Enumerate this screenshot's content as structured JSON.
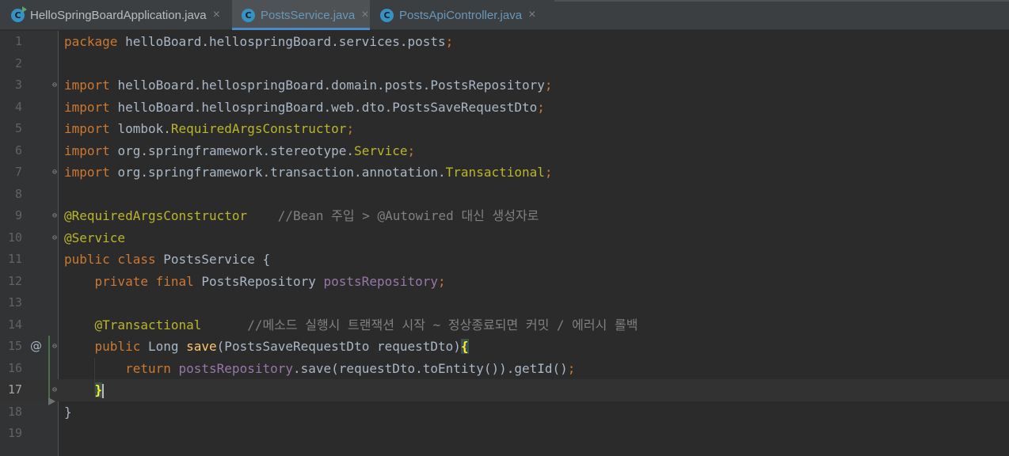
{
  "tabs": [
    {
      "label": "HelloSpringBoardApplication.java",
      "icon": "class-run-icon",
      "active": false
    },
    {
      "label": "PostsService.java",
      "icon": "class-icon",
      "active": true
    },
    {
      "label": "PostsApiController.java",
      "icon": "class-icon",
      "active": false
    }
  ],
  "tab_close_glyph": "×",
  "tab_icon_letter": "C",
  "gutter_marker": "@",
  "current_line": 17,
  "lines": [
    {
      "n": "1",
      "t": [
        [
          "kw",
          "package "
        ],
        [
          "pl",
          "helloBoard.hellospringBoard.services.posts"
        ],
        [
          "kw",
          ";"
        ]
      ]
    },
    {
      "n": "2",
      "t": []
    },
    {
      "n": "3",
      "t": [
        [
          "kw",
          "import "
        ],
        [
          "pl",
          "helloBoard.hellospringBoard.domain.posts.PostsRepository"
        ],
        [
          "kw",
          ";"
        ]
      ]
    },
    {
      "n": "4",
      "t": [
        [
          "kw",
          "import "
        ],
        [
          "pl",
          "helloBoard.hellospringBoard.web.dto.PostsSaveRequestDto"
        ],
        [
          "kw",
          ";"
        ]
      ]
    },
    {
      "n": "5",
      "t": [
        [
          "kw",
          "import "
        ],
        [
          "pl",
          "lombok."
        ],
        [
          "an",
          "RequiredArgsConstructor"
        ],
        [
          "kw",
          ";"
        ]
      ]
    },
    {
      "n": "6",
      "t": [
        [
          "kw",
          "import "
        ],
        [
          "pl",
          "org.springframework.stereotype."
        ],
        [
          "an",
          "Service"
        ],
        [
          "kw",
          ";"
        ]
      ]
    },
    {
      "n": "7",
      "t": [
        [
          "kw",
          "import "
        ],
        [
          "pl",
          "org.springframework.transaction.annotation."
        ],
        [
          "an",
          "Transactional"
        ],
        [
          "kw",
          ";"
        ]
      ]
    },
    {
      "n": "8",
      "t": []
    },
    {
      "n": "9",
      "t": [
        [
          "an",
          "@RequiredArgsConstructor"
        ],
        [
          "cm",
          "    //Bean 주입 > @Autowired 대신 생성자로"
        ]
      ]
    },
    {
      "n": "10",
      "t": [
        [
          "an",
          "@Service"
        ]
      ]
    },
    {
      "n": "11",
      "t": [
        [
          "kw",
          "public class "
        ],
        [
          "pl",
          "PostsService {"
        ]
      ]
    },
    {
      "n": "12",
      "t": [
        [
          "pl",
          "    "
        ],
        [
          "kw",
          "private final "
        ],
        [
          "pl",
          "PostsRepository "
        ],
        [
          "fld",
          "postsRepository"
        ],
        [
          "kw",
          ";"
        ]
      ]
    },
    {
      "n": "13",
      "t": []
    },
    {
      "n": "14",
      "t": [
        [
          "pl",
          "    "
        ],
        [
          "an",
          "@Transactional"
        ],
        [
          "cm",
          "      //메소드 실행시 트랜잭션 시작 ~ 정상종료되면 커밋 / 에러시 롤백"
        ]
      ]
    },
    {
      "n": "15",
      "t": [
        [
          "pl",
          "    "
        ],
        [
          "kw",
          "public "
        ],
        [
          "pl",
          "Long "
        ],
        [
          "fn",
          "save"
        ],
        [
          "pl",
          "(PostsSaveRequestDto requestDto)"
        ],
        [
          "brace",
          "{"
        ]
      ]
    },
    {
      "n": "16",
      "t": [
        [
          "pl",
          "        "
        ],
        [
          "kw",
          "return "
        ],
        [
          "fld",
          "postsRepository"
        ],
        [
          "pl",
          ".save(requestDto.toEntity()).getId()"
        ],
        [
          "kw",
          ";"
        ]
      ]
    },
    {
      "n": "17",
      "t": [
        [
          "pl",
          "    "
        ],
        [
          "brace",
          "}"
        ],
        [
          "cursor",
          ""
        ]
      ]
    },
    {
      "n": "18",
      "t": [
        [
          "pl",
          "}"
        ]
      ]
    },
    {
      "n": "19",
      "t": []
    }
  ]
}
